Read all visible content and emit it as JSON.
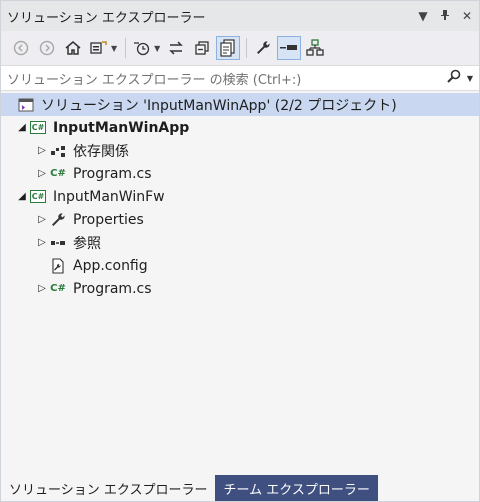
{
  "window": {
    "title": "ソリューション エクスプローラー",
    "menu_glyph": "▼",
    "pin_glyph": "ꟷ",
    "close_glyph": "✕"
  },
  "search": {
    "placeholder": "ソリューション エクスプローラー の検索 (Ctrl+:)"
  },
  "tree": {
    "solution": "ソリューション 'InputManWinApp' (2/2 プロジェクト)",
    "projects": [
      {
        "name": "InputManWinApp",
        "expanded": true,
        "children": [
          {
            "label": "依存関係",
            "icon": "dependencies-icon",
            "expandable": true
          },
          {
            "label": "Program.cs",
            "icon": "csharp-file-icon",
            "expandable": true
          }
        ]
      },
      {
        "name": "InputManWinFw",
        "expanded": true,
        "children": [
          {
            "label": "Properties",
            "icon": "wrench-icon",
            "expandable": true
          },
          {
            "label": "参照",
            "icon": "references-icon",
            "expandable": true
          },
          {
            "label": "App.config",
            "icon": "config-file-icon",
            "expandable": false
          },
          {
            "label": "Program.cs",
            "icon": "csharp-file-icon",
            "expandable": true
          }
        ]
      }
    ]
  },
  "tabs": [
    {
      "label": "ソリューション エクスプローラー",
      "active": true
    },
    {
      "label": "チーム エクスプローラー",
      "active": false
    }
  ],
  "colors": {
    "accent": "#c9d8f0",
    "tab_bar": "#2d3c6b",
    "csharp_green": "#2a7a3a"
  }
}
